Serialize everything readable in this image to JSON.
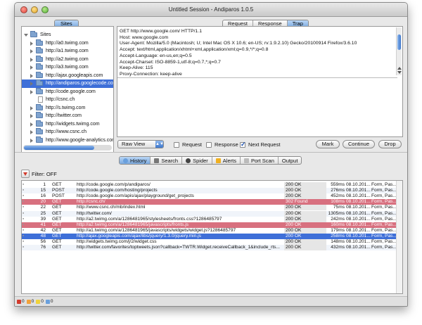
{
  "window": {
    "title": "Untitled Session - Andiparos 1.0.5"
  },
  "sites_tab": {
    "label": "Sites"
  },
  "request_tabs": [
    "Request",
    "Response",
    "Trap"
  ],
  "tree": {
    "root": "Sites",
    "items": [
      "http://a0.twimg.com",
      "http://a1.twimg.com",
      "http://a2.twimg.com",
      "http://a3.twimg.com",
      "http://ajax.googleapis.com",
      "http://andiparos.googlecode.com",
      "http://code.google.com",
      "http://csnc.ch",
      "http://s.twimg.com",
      "http://twitter.com",
      "http://widgets.twimg.com",
      "http://www.csnc.ch",
      "http://www.google-analytics.com"
    ],
    "selected_index": 5,
    "leaf_index": 7
  },
  "request_text": [
    "GET http://www.google.com/ HTTP/1.1",
    "Host: www.google.com",
    "User-Agent: Mozilla/5.0 (Macintosh; U; Intel Mac OS X 10.6; en-US; rv:1.9.2.10) Gecko/20100914 Firefox/3.6.10",
    "Accept: text/html,application/xhtml+xml,application/xml;q=0.9,*/*;q=0.8",
    "Accept-Language: en-us,en;q=0.5",
    "Accept-Charset: ISO-8859-1,utf-8;q=0.7,*;q=0.7",
    "Keep-Alive: 115",
    "Proxy-Connection: keep-alive"
  ],
  "view_select": {
    "value": "Raw View"
  },
  "trap_controls": {
    "request_label": "Request",
    "response_label": "Response",
    "next_request_label": "Next Request",
    "next_request_checked": true
  },
  "buttons": {
    "mark": "Mark",
    "continue": "Continue",
    "drop": "Drop"
  },
  "bottom_tabs": [
    "History",
    "Search",
    "Spider",
    "Alerts",
    "Port Scan",
    "Output"
  ],
  "filter": {
    "label": "Filter: OFF"
  },
  "history": [
    {
      "id": "1",
      "method": "GET",
      "url": "http://code.google.com/p/andiparos/",
      "status": "200 OK",
      "time": "559ms",
      "date": "08.10.201...",
      "note": "Form, Pas...",
      "hl": ""
    },
    {
      "id": "15",
      "method": "POST",
      "url": "http://code.google.com/hosting/projects",
      "status": "200 OK",
      "time": "276ms",
      "date": "08.10.201...",
      "note": "Form, Pas...",
      "hl": ""
    },
    {
      "id": "16",
      "method": "POST",
      "url": "http://code.google.com/apis/ajax/playground/get_projects",
      "status": "200 OK",
      "time": "452ms",
      "date": "08.10.201...",
      "note": "Form, Pas...",
      "hl": ""
    },
    {
      "id": "20",
      "method": "GET",
      "url": "http://csnc.ch/",
      "status": "302 Found",
      "time": "108ms",
      "date": "08.10.201...",
      "note": "Form, Pas...",
      "hl": "red"
    },
    {
      "id": "22",
      "method": "GET",
      "url": "http://www.csnc.ch/mb/index.html",
      "status": "200 OK",
      "time": "75ms",
      "date": "08.10.201...",
      "note": "Form, Pas...",
      "hl": ""
    },
    {
      "id": "25",
      "method": "GET",
      "url": "http://twitter.com/",
      "status": "200 OK",
      "time": "1305ms",
      "date": "08.10.201...",
      "note": "Form, Pas...",
      "hl": ""
    },
    {
      "id": "39",
      "method": "GET",
      "url": "http://a2.twimg.com/a/1286481965/stylesheets/fronts.css?1286485797",
      "status": "200 OK",
      "time": "242ms",
      "date": "08.10.201...",
      "note": "Form, Pas...",
      "hl": ""
    },
    {
      "id": "41",
      "method": "GET",
      "url": "http://a2.twimg.com/a/1286481965/javascripts/fronts.js",
      "status": "200 OK",
      "time": "160ms",
      "date": "08.10.201...",
      "note": "Form, Pas...",
      "hl": "red"
    },
    {
      "id": "42",
      "method": "GET",
      "url": "http://a1.twimg.com/a/1286481965/javascripts/widgets/widget.js?1286485797",
      "status": "200 OK",
      "time": "179ms",
      "date": "08.10.201...",
      "note": "Form, Pas...",
      "hl": ""
    },
    {
      "id": "48",
      "method": "GET",
      "url": "http://ajax.googleapis.com/ajax/libs/jquery/1.3.0/jquery.min.js",
      "status": "200 OK",
      "time": "258ms",
      "date": "08.10.201...",
      "note": "Form, Pas...",
      "hl": "blue"
    },
    {
      "id": "56",
      "method": "GET",
      "url": "http://widgets.twimg.com/j/2/widget.css",
      "status": "200 OK",
      "time": "148ms",
      "date": "08.10.201...",
      "note": "Form, Pas...",
      "hl": ""
    },
    {
      "id": "76",
      "method": "GET",
      "url": "http://twitter.com/favorites/toptweets.json?callback=TWTR.Widget.receiveCallback_1&include_rts...",
      "status": "200 OK",
      "time": "432ms",
      "date": "08.10.201...",
      "note": "Form, Pas...",
      "hl": ""
    }
  ],
  "status_counts": [
    {
      "color": "#d23a2c",
      "count": "0"
    },
    {
      "color": "#f2a23a",
      "count": "0"
    },
    {
      "color": "#f0d23a",
      "count": "0"
    },
    {
      "color": "#6aa0dd",
      "count": "0"
    }
  ]
}
